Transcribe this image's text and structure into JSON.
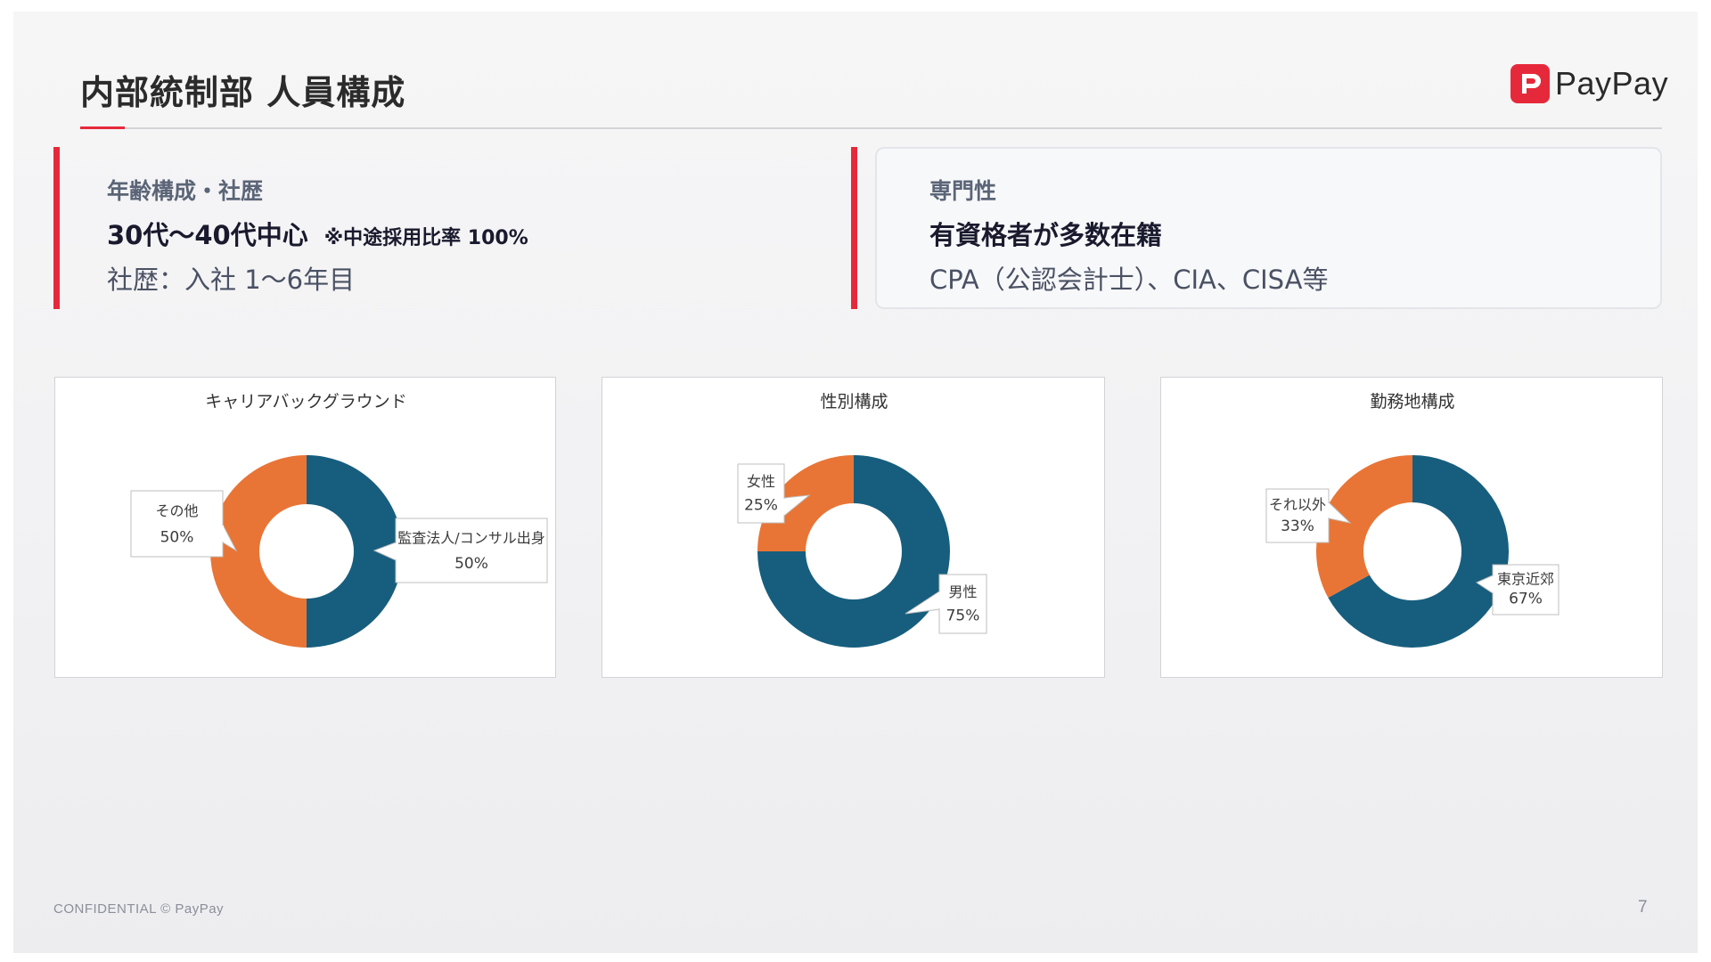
{
  "header": {
    "title": "内部統制部 人員構成",
    "logo_text": "PayPay",
    "logo_color": "#e6293a"
  },
  "summary_boxes": [
    {
      "heading": "年齢構成・社歴",
      "main": "30代〜40代中心",
      "note": "※中途採用比率 100%",
      "sub": "社歴：入社 1〜6年目"
    },
    {
      "heading": "専門性",
      "main": "有資格者が多数在籍",
      "sub": "CPA（公認会計士）、CIA、CISA等"
    }
  ],
  "chart_data": [
    {
      "type": "pie",
      "title": "キャリアバックグラウンド",
      "labels": [
        "監査法人/コンサル出身",
        "その他"
      ],
      "values": [
        50,
        50
      ],
      "value_labels": [
        "50%",
        "50%"
      ],
      "colors": [
        "#175e7e",
        "#e87536"
      ]
    },
    {
      "type": "pie",
      "title": "性別構成",
      "labels": [
        "男性",
        "女性"
      ],
      "values": [
        75,
        25
      ],
      "value_labels": [
        "75%",
        "25%"
      ],
      "colors": [
        "#175e7e",
        "#e87536"
      ]
    },
    {
      "type": "pie",
      "title": "勤務地構成",
      "labels": [
        "東京近郊",
        "それ以外"
      ],
      "values": [
        67,
        33
      ],
      "value_labels": [
        "67%",
        "33%"
      ],
      "colors": [
        "#175e7e",
        "#e87536"
      ]
    }
  ],
  "footer": {
    "confidential": "CONFIDENTIAL © PayPay",
    "page_number": "7"
  }
}
